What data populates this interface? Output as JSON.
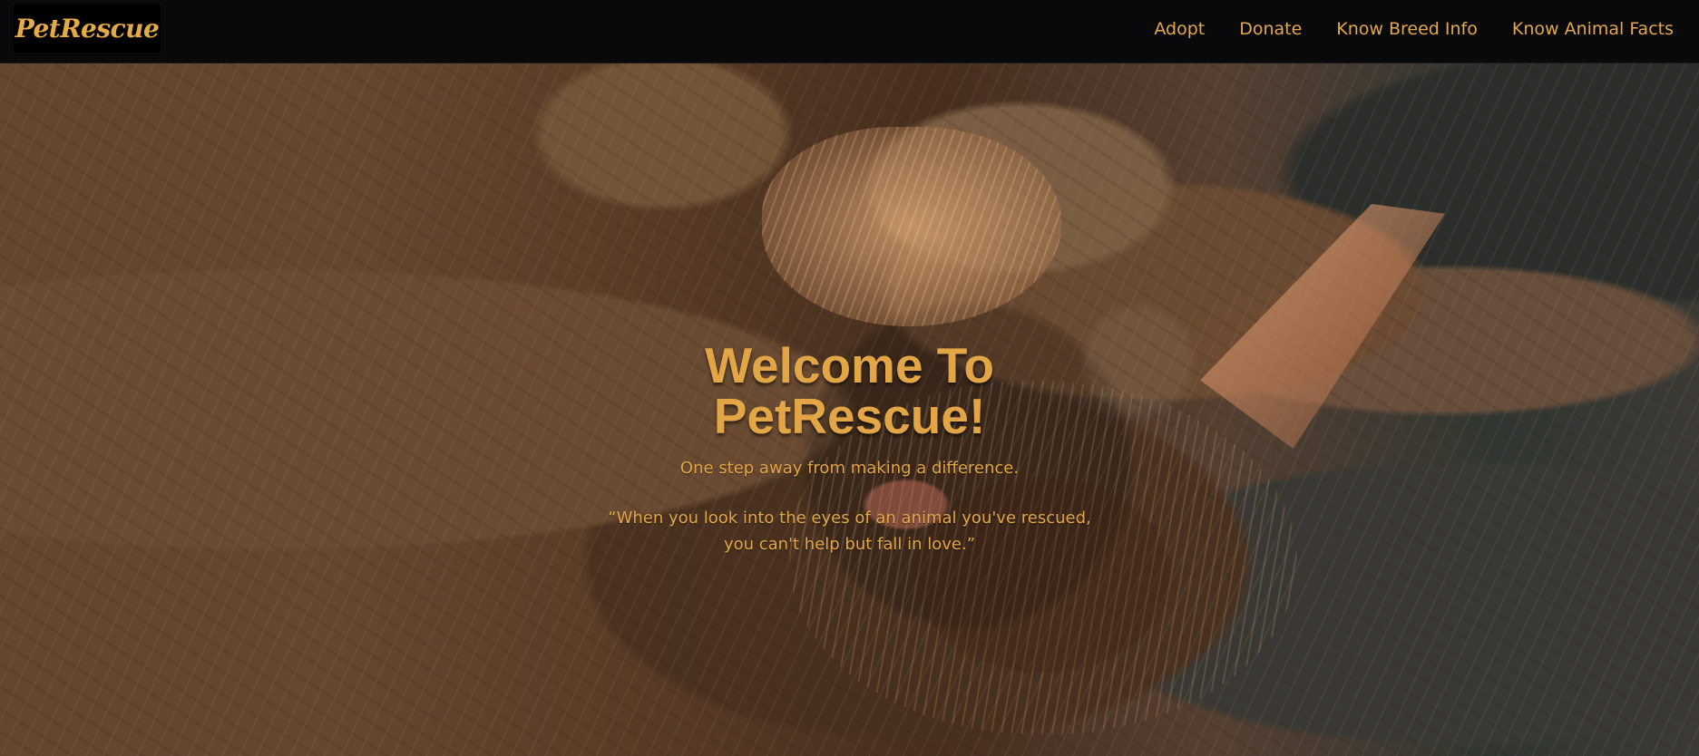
{
  "navbar": {
    "brand": "PetRescue",
    "links": [
      {
        "label": "Adopt"
      },
      {
        "label": "Donate"
      },
      {
        "label": "Know Breed Info"
      },
      {
        "label": "Know Animal Facts"
      }
    ]
  },
  "hero": {
    "title": "Welcome To PetRescue!",
    "subtitle": "One step away from making a difference.",
    "quote": "“When you look into the eyes of an animal you've rescued, you can't help but fall in love.”"
  },
  "colors": {
    "accent": "#e3a646",
    "navbar": "#09090b"
  }
}
